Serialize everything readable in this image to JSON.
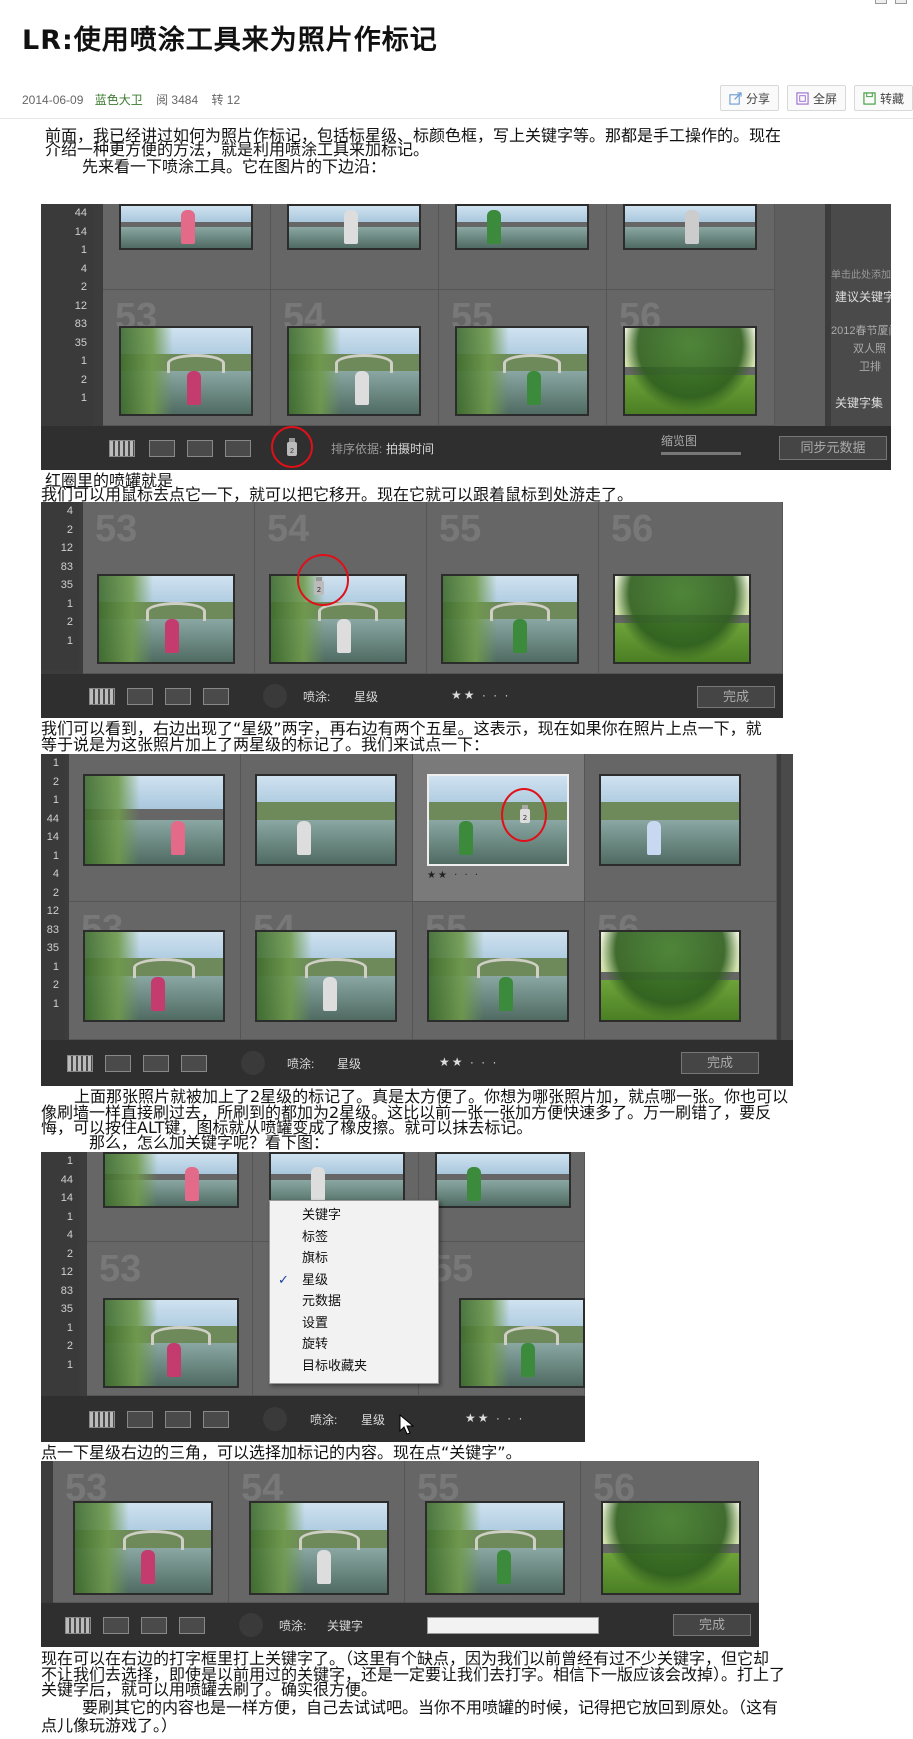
{
  "article": {
    "title": "LR:使用喷涂工具来为照片作标记",
    "date": "2014-06-09",
    "author": "蓝色大卫",
    "reads": "阅 3484",
    "reposts": "转 12"
  },
  "actions": {
    "share": "分享",
    "fullscreen": "全屏",
    "collect": "转藏"
  },
  "paragraphs": {
    "p1a": "前面，我已经讲过如何为照片作标记，包括标星级、标颜色框，写上关键字等。那都是手工操作的。现在",
    "p1b": "介绍一种更方便的方法，就是利用喷涂工具来加标记。",
    "p1c": "先来看一下喷涂工具。它在图片的下边沿：",
    "p2a": "红圈里的喷罐就是",
    "p2b": "我们可以用鼠标去点它一下，就可以把它移开。现在它就可以跟着鼠标到处游走了。",
    "p3a": "我们可以看到，右边出现了“星级”两字，再右边有两个五星。这表示，现在如果你在照片上点一下，就",
    "p3b": "等于说是为这张照片加上了两星级的标记了。我们来试点一下：",
    "p4a": "上面那张照片就被加上了2星级的标记了。真是太方便了。你想为哪张照片加，就点哪一张。你也可以",
    "p4b": "像刷墙一样直接刷过去，所刷到的都加为2星级。这比以前一张一张加方便快速多了。万一刷错了，要反",
    "p4c": "悔，可以按住ALT键，图标就从喷罐变成了橡皮擦。就可以抹去标记。",
    "p4d": "那么，怎么加关键字呢？看下图：",
    "p5": "点一下星级右边的三角，可以选择加标记的内容。现在点“关键字”。",
    "p6a": "现在可以在右边的打字框里打上关键字了。（这里有个缺点，因为我们以前曾经有过不少关键字，但它却",
    "p6b": "不让我们去选择，即使是以前用过的关键字，还是一定要让我们去打字。相信下一版应该会改掉）。打上了",
    "p6c": "关键字后，就可以用喷罐去刷了。确实很方便。",
    "p6d": "要刷其它的内容也是一样方便，自己去试试吧。当你不用喷罐的时候，记得把它放回到原处。（这有",
    "p6e": "点儿像玩游戏了。）"
  },
  "lr": {
    "side1": [
      "44",
      "14",
      "1",
      "4",
      "2",
      "12",
      "83",
      "35",
      "1",
      "2",
      "1"
    ],
    "side2": [
      "4",
      "2",
      "12",
      "83",
      "35",
      "1",
      "2",
      "1"
    ],
    "side3": [
      "1",
      "2",
      "1",
      "44",
      "14",
      "1",
      "4",
      "2",
      "12",
      "83",
      "35",
      "1",
      "2",
      "1"
    ],
    "side4": [
      "1",
      "44",
      "14",
      "1",
      "4",
      "2",
      "12",
      "83",
      "35",
      "1",
      "2",
      "1"
    ],
    "cells_top": [
      "53",
      "54",
      "55",
      "56"
    ],
    "sort_label": "排序依据:",
    "sort_value": "拍摄时间",
    "thumb_label": "缩览图",
    "suggest_kw": "建议关键字",
    "kw_set": "关键字集",
    "sync_btn": "同步元数据",
    "kw_hint": "单击此处添加关键",
    "kw1": "2012春节厦门...",
    "kw2": "双人照",
    "kw3": "卫排",
    "spray_label": "喷涂:",
    "spray_mode_star": "星级",
    "spray_mode_kw": "关键字",
    "stars": "★★ · · ·",
    "done": "完成",
    "menu": [
      "关键字",
      "标签",
      "旗标",
      "星级",
      "元数据",
      "设置",
      "旋转",
      "目标收藏夹"
    ],
    "menu_checked": 3
  }
}
